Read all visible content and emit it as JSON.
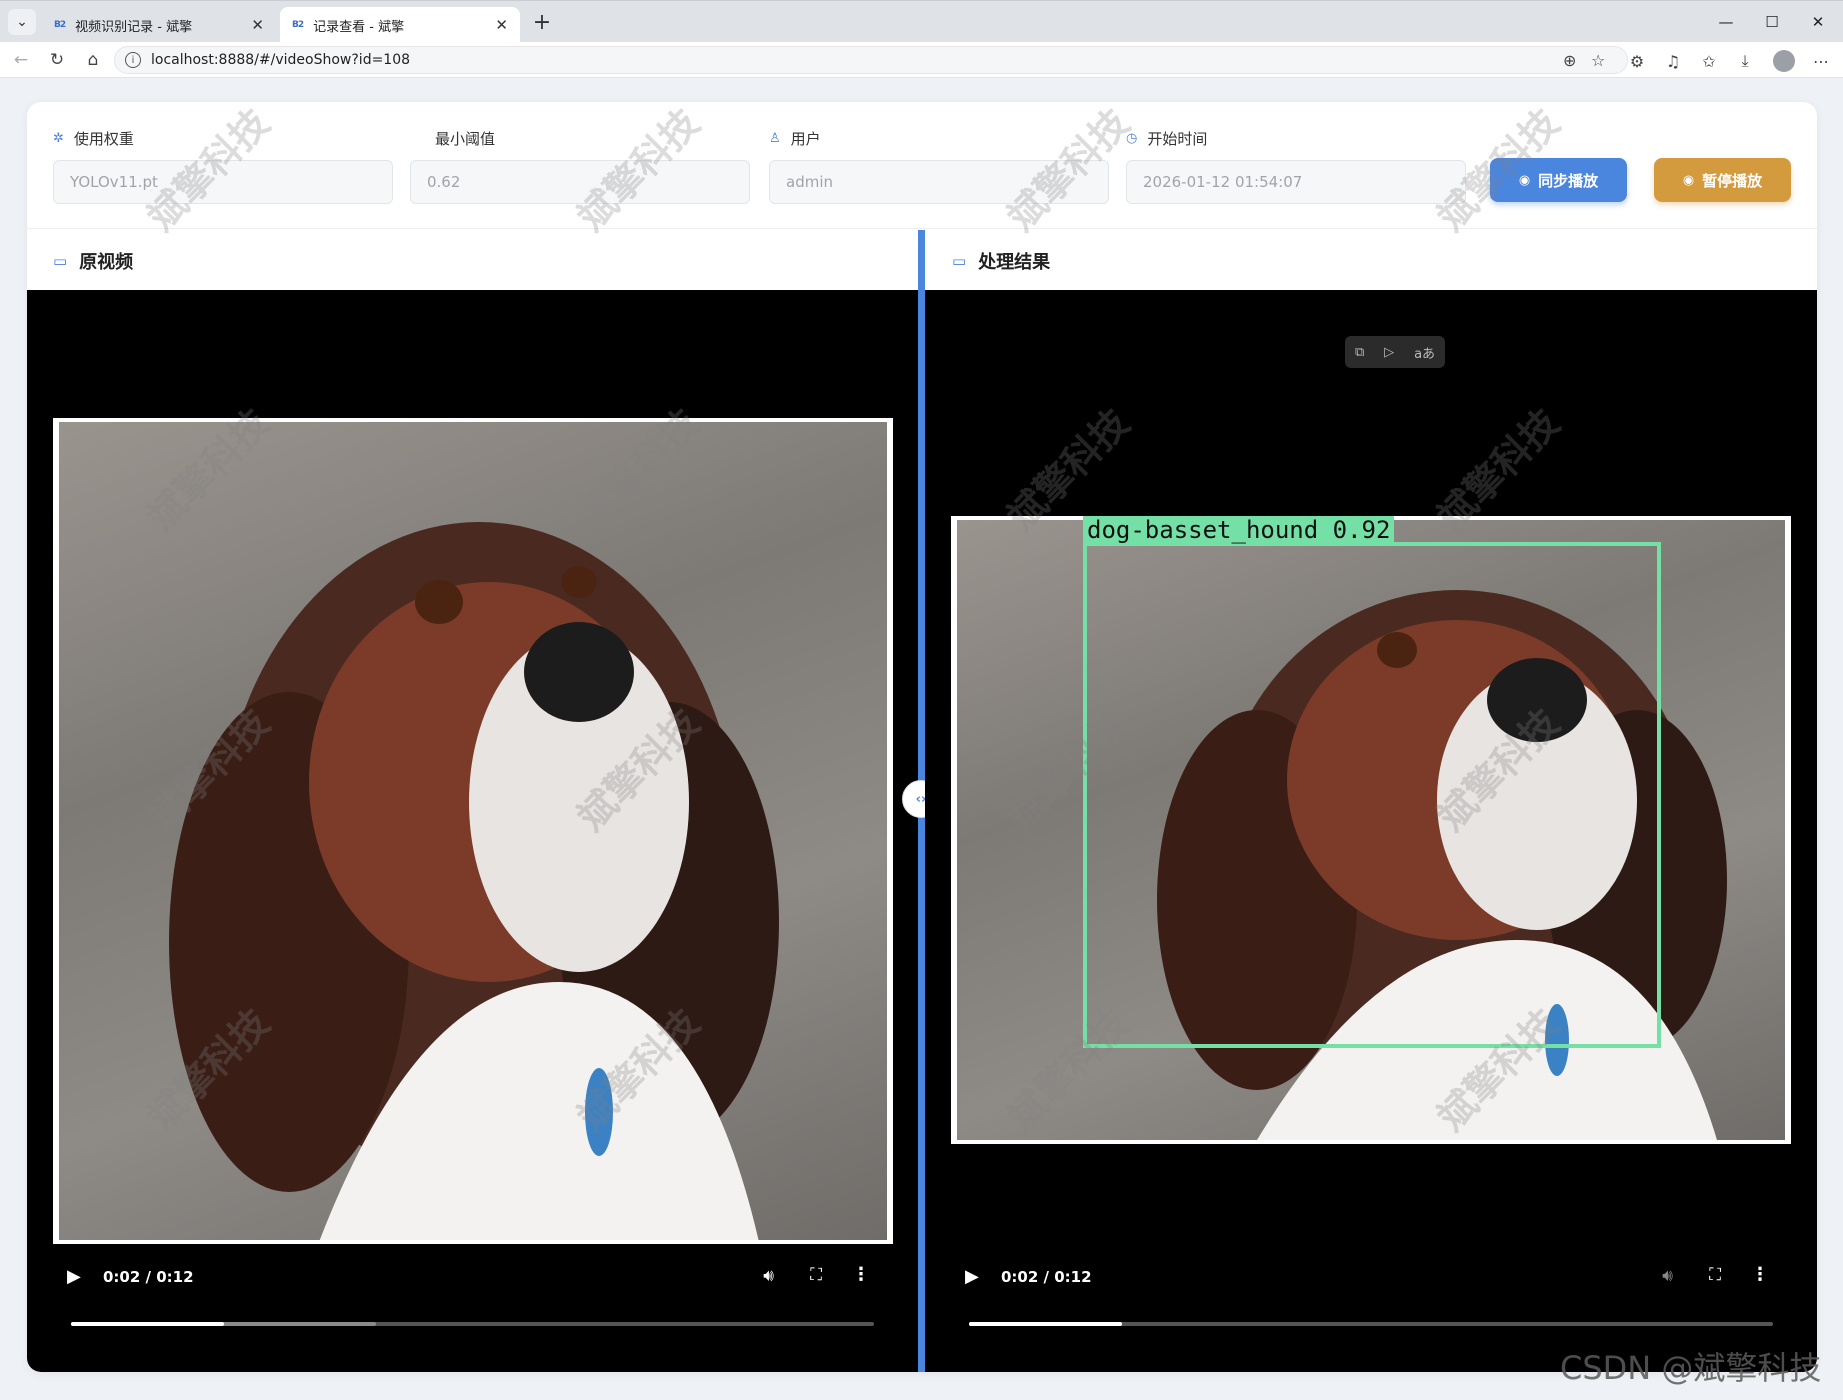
{
  "browser": {
    "tabs": [
      {
        "favicon": "B2",
        "title": "视频识别记录 - 斌擎"
      },
      {
        "favicon": "B2",
        "title": "记录查看 - 斌擎"
      }
    ],
    "url": "localhost:8888/#/videoShow?id=108"
  },
  "filters": {
    "weight": {
      "label": "使用权重",
      "value": "YOLOv11.pt",
      "icon": "cpu-icon"
    },
    "threshold": {
      "label": "最小阈值",
      "value": "0.62"
    },
    "user": {
      "label": "用户",
      "value": "admin",
      "icon": "user-icon"
    },
    "start_time": {
      "label": "开始时间",
      "value": "2026-01-12 01:54:07",
      "icon": "clock-icon"
    }
  },
  "buttons": {
    "sync_play": "同步播放",
    "pause_play": "暂停播放"
  },
  "panels": {
    "original": {
      "title": "原视频",
      "icon": "video-camera-icon"
    },
    "result": {
      "title": "处理结果",
      "icon": "monitor-icon"
    }
  },
  "players": {
    "left": {
      "time": "0:02 / 0:12",
      "played_fraction": 0.19,
      "buffered_fraction": 0.38
    },
    "right": {
      "time": "0:02 / 0:12",
      "played_fraction": 0.19,
      "buffered_fraction": 0.19
    }
  },
  "detection": {
    "label": "dog-basset_hound 0.92",
    "color": "#74e0a6"
  },
  "watermark": "斌擎科技",
  "footer_watermark": "CSDN @斌擎科技",
  "colors": {
    "accent": "#4b86de",
    "pause": "#d49a3e"
  }
}
